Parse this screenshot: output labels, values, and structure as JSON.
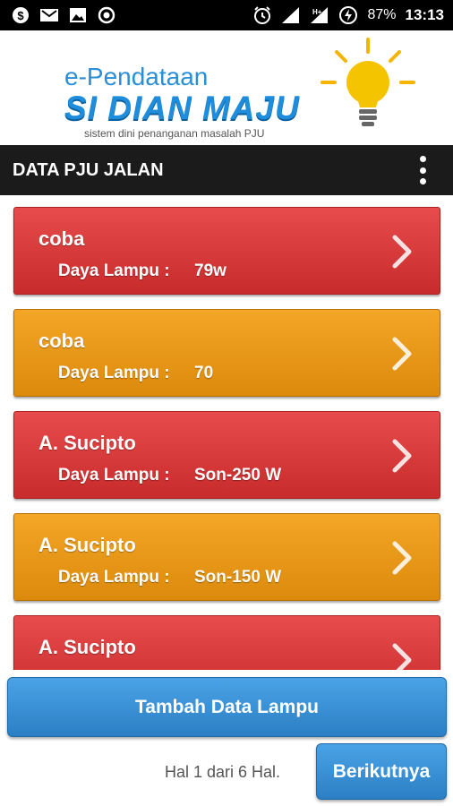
{
  "status_bar": {
    "left_icons": [
      "dollar-icon",
      "mail-icon",
      "image-icon",
      "record-icon"
    ],
    "right_icons": [
      "alarm-icon",
      "signal-icon",
      "network-h-icon",
      "battery-saver-icon"
    ],
    "battery": "87%",
    "time": "13:13"
  },
  "header": {
    "logo_line1": "e-Pendataan",
    "logo_line2": "SI DIAN MAJU",
    "logo_tagline": "sistem dini penanganan masalah PJU"
  },
  "toolbar": {
    "title": "DATA PJU JALAN",
    "menu_icon": "overflow-menu-icon"
  },
  "colors": {
    "card_red": "#d93a3a",
    "card_orange": "#ea9b1a",
    "button_blue": "#3a92d6",
    "toolbar": "#1b1b1b"
  },
  "items": [
    {
      "name": "coba",
      "label": "Daya Lampu :",
      "value": "79w",
      "color": "red"
    },
    {
      "name": "coba",
      "label": "Daya Lampu :",
      "value": "70",
      "color": "orange"
    },
    {
      "name": "A. Sucipto",
      "label": "Daya Lampu :",
      "value": "Son-250 W",
      "color": "red"
    },
    {
      "name": "A. Sucipto",
      "label": "Daya Lampu :",
      "value": "Son-150 W",
      "color": "orange"
    },
    {
      "name": "A. Sucipto",
      "label": "",
      "value": "",
      "color": "red"
    }
  ],
  "footer": {
    "add_button": "Tambah Data Lampu",
    "page_info": "Hal 1 dari 6 Hal.",
    "next_button": "Berikutnya"
  }
}
